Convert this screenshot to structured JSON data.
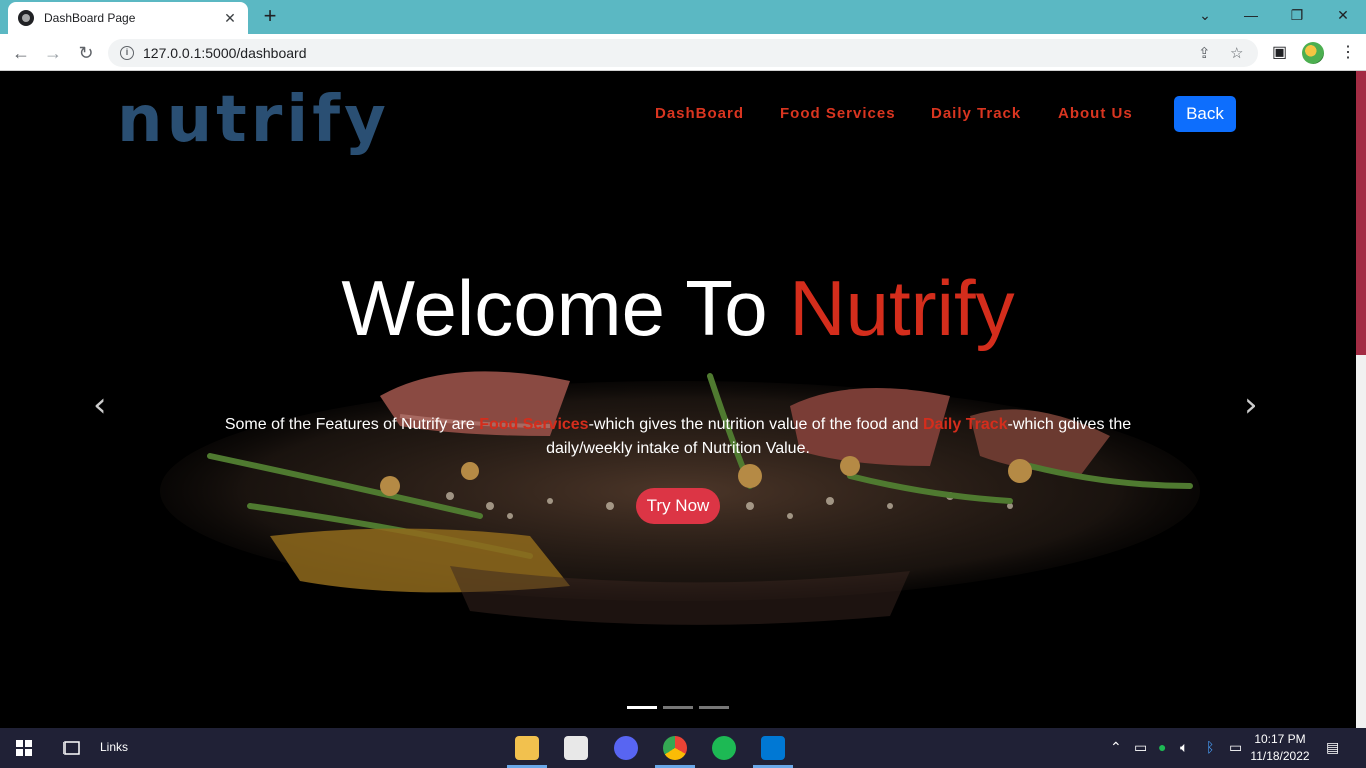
{
  "browser": {
    "tab_title": "DashBoard Page",
    "url": "127.0.0.1:5000/dashboard"
  },
  "navbar": {
    "logo": "nutrify",
    "items": [
      "DashBoard",
      "Food Services",
      "Daily Track",
      "About Us"
    ],
    "back_label": "Back"
  },
  "hero": {
    "headline_prefix": "Welcome To ",
    "headline_accent": "Nutrify",
    "desc_part1": "Some of the Features of Nutrify are ",
    "desc_hl1": "Food Services",
    "desc_part2": "-which gives the nutrition value of the food and ",
    "desc_hl2": "Daily Track",
    "desc_part3": "-which gdives the daily/weekly intake of Nutrition Value.",
    "cta_label": "Try Now",
    "active_slide": 1,
    "slide_count": 3
  },
  "taskbar": {
    "links_label": "Links",
    "time": "10:17 PM",
    "date": "11/18/2022"
  },
  "colors": {
    "accent_red": "#d42d1c",
    "logo_blue": "#2a4f73",
    "button_blue": "#0d6efd",
    "cta_red": "#dc3545",
    "tab_bar": "#5bb8c3"
  }
}
